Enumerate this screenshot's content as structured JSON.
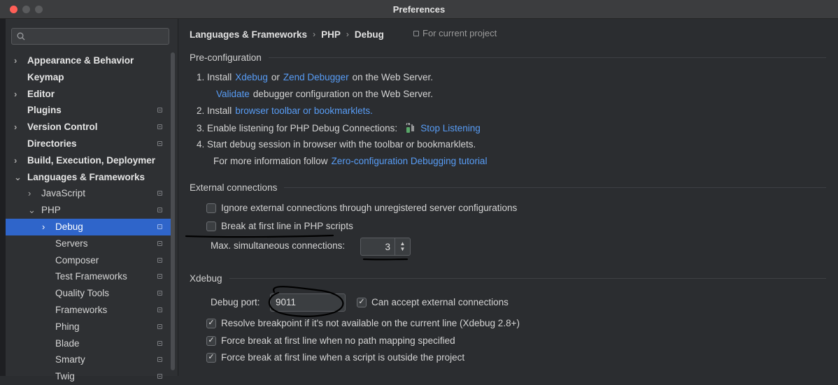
{
  "window": {
    "title": "Preferences"
  },
  "sidebar": {
    "search_placeholder": "",
    "items": [
      {
        "label": "Appearance & Behavior",
        "bold": true,
        "arrow": "›",
        "level": 0,
        "proj": false
      },
      {
        "label": "Keymap",
        "bold": true,
        "arrow": "",
        "level": 0,
        "proj": false
      },
      {
        "label": "Editor",
        "bold": true,
        "arrow": "›",
        "level": 0,
        "proj": false
      },
      {
        "label": "Plugins",
        "bold": true,
        "arrow": "",
        "level": 0,
        "proj": true
      },
      {
        "label": "Version Control",
        "bold": true,
        "arrow": "›",
        "level": 0,
        "proj": true
      },
      {
        "label": "Directories",
        "bold": true,
        "arrow": "",
        "level": 0,
        "proj": true
      },
      {
        "label": "Build, Execution, Deploymer",
        "bold": true,
        "arrow": "›",
        "level": 0,
        "proj": false
      },
      {
        "label": "Languages & Frameworks",
        "bold": true,
        "arrow": "⌄",
        "level": 0,
        "proj": false
      },
      {
        "label": "JavaScript",
        "bold": false,
        "arrow": "›",
        "level": 1,
        "proj": true
      },
      {
        "label": "PHP",
        "bold": false,
        "arrow": "⌄",
        "level": 1,
        "proj": true
      },
      {
        "label": "Debug",
        "bold": false,
        "arrow": "›",
        "level": 2,
        "proj": true,
        "selected": true
      },
      {
        "label": "Servers",
        "bold": false,
        "arrow": "",
        "level": 2,
        "proj": true
      },
      {
        "label": "Composer",
        "bold": false,
        "arrow": "",
        "level": 2,
        "proj": true
      },
      {
        "label": "Test Frameworks",
        "bold": false,
        "arrow": "",
        "level": 2,
        "proj": true
      },
      {
        "label": "Quality Tools",
        "bold": false,
        "arrow": "",
        "level": 2,
        "proj": true
      },
      {
        "label": "Frameworks",
        "bold": false,
        "arrow": "",
        "level": 2,
        "proj": true
      },
      {
        "label": "Phing",
        "bold": false,
        "arrow": "",
        "level": 2,
        "proj": true
      },
      {
        "label": "Blade",
        "bold": false,
        "arrow": "",
        "level": 2,
        "proj": true
      },
      {
        "label": "Smarty",
        "bold": false,
        "arrow": "",
        "level": 2,
        "proj": true
      },
      {
        "label": "Twig",
        "bold": false,
        "arrow": "",
        "level": 2,
        "proj": true
      }
    ]
  },
  "breadcrumb": {
    "parts": [
      "Languages & Frameworks",
      "PHP",
      "Debug"
    ],
    "separator": "›",
    "scope": "For current project"
  },
  "preconfig": {
    "title": "Pre-configuration",
    "step1_prefix": "1. Install",
    "step1_link1": "Xdebug",
    "step1_or": "or",
    "step1_link2": "Zend Debugger",
    "step1_suffix": "on the Web Server.",
    "validate_link": "Validate",
    "validate_suffix": "debugger configuration on the Web Server.",
    "step2_prefix": "2. Install",
    "step2_link": "browser toolbar or bookmarklets.",
    "step3_prefix": "3. Enable listening for PHP Debug Connections:",
    "step3_link": "Stop Listening",
    "step4": "4. Start debug session in browser with the toolbar or bookmarklets.",
    "more_prefix": "For more information follow",
    "more_link": "Zero-configuration Debugging tutorial"
  },
  "external": {
    "title": "External connections",
    "ignore_label": "Ignore external connections through unregistered server configurations",
    "ignore_checked": false,
    "break_label": "Break at first line in PHP scripts",
    "break_checked": false,
    "max_label": "Max. simultaneous connections:",
    "max_value": "3"
  },
  "xdebug": {
    "title": "Xdebug",
    "port_label": "Debug port:",
    "port_value": "9011",
    "accept_label": "Can accept external connections",
    "accept_checked": true,
    "resolve_label": "Resolve breakpoint if it's not available on the current line (Xdebug 2.8+)",
    "resolve_checked": true,
    "force_mapping_label": "Force break at first line when no path mapping specified",
    "force_mapping_checked": true,
    "force_outside_label": "Force break at first line when a script is outside the project",
    "force_outside_checked": true
  },
  "colors": {
    "accent": "#2f65ca",
    "link": "#589df6",
    "background": "#2b2d30",
    "sidebar": "#2e3033",
    "annotation": "#000000"
  },
  "icons": {
    "search": "search-icon",
    "project_scope": "project-scope-icon",
    "listening": "debug-listen-icon",
    "checkmark": "✓"
  }
}
